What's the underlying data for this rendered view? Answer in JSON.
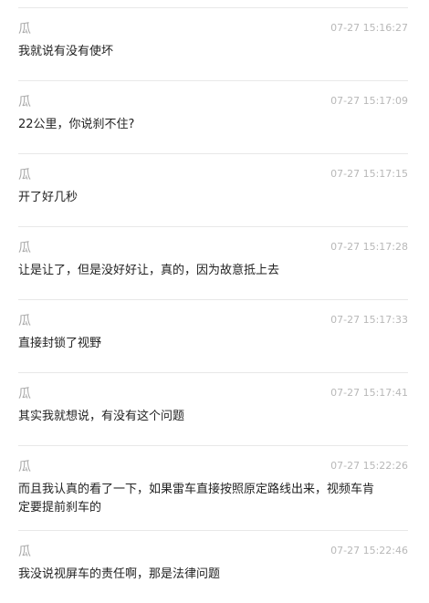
{
  "messages": [
    {
      "sender": "瓜",
      "time": "07-27 15:16:27",
      "text": "我就说有没有使坏"
    },
    {
      "sender": "瓜",
      "time": "07-27 15:17:09",
      "text": "22公里，你说刹不住?"
    },
    {
      "sender": "瓜",
      "time": "07-27 15:17:15",
      "text": "开了好几秒"
    },
    {
      "sender": "瓜",
      "time": "07-27 15:17:28",
      "text": "让是让了，但是没好好让，真的，因为故意抵上去"
    },
    {
      "sender": "瓜",
      "time": "07-27 15:17:33",
      "text": "直接封锁了视野"
    },
    {
      "sender": "瓜",
      "time": "07-27 15:17:41",
      "text": "其实我就想说，有没有这个问题"
    },
    {
      "sender": "瓜",
      "time": "07-27 15:22:26",
      "text": "而且我认真的看了一下，如果雷车直接按照原定路线出来，视频车肯定要提前刹车的"
    },
    {
      "sender": "瓜",
      "time": "07-27 15:22:46",
      "text": "我没说视屏车的责任啊，那是法律问题"
    }
  ]
}
